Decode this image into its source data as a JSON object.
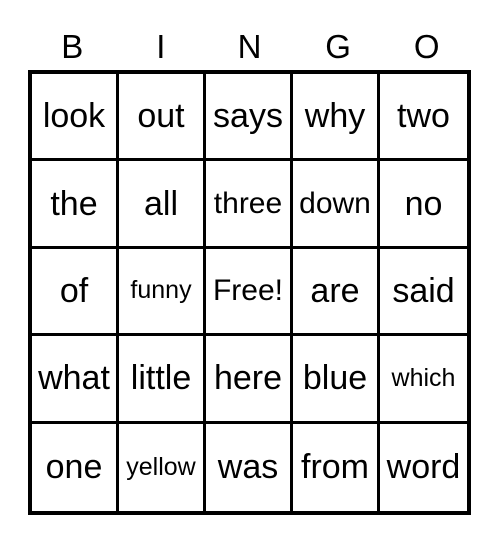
{
  "card": {
    "title_letters": [
      "B",
      "I",
      "N",
      "G",
      "O"
    ],
    "border_color": "#000000",
    "background_color": "#ffffff",
    "text_color": "#000000",
    "rows": 5,
    "columns": 5,
    "free_space": "Free!",
    "cells": [
      [
        {
          "text": "look",
          "size": "lg"
        },
        {
          "text": "out",
          "size": "lg"
        },
        {
          "text": "says",
          "size": "lg"
        },
        {
          "text": "why",
          "size": "lg"
        },
        {
          "text": "two",
          "size": "lg"
        }
      ],
      [
        {
          "text": "the",
          "size": "lg"
        },
        {
          "text": "all",
          "size": "lg"
        },
        {
          "text": "three",
          "size": "md"
        },
        {
          "text": "down",
          "size": "md"
        },
        {
          "text": "no",
          "size": "lg"
        }
      ],
      [
        {
          "text": "of",
          "size": "lg"
        },
        {
          "text": "funny",
          "size": "sm"
        },
        {
          "text": "Free!",
          "size": "md"
        },
        {
          "text": "are",
          "size": "lg"
        },
        {
          "text": "said",
          "size": "lg"
        }
      ],
      [
        {
          "text": "what",
          "size": "lg"
        },
        {
          "text": "little",
          "size": "lg"
        },
        {
          "text": "here",
          "size": "lg"
        },
        {
          "text": "blue",
          "size": "lg"
        },
        {
          "text": "which",
          "size": "sm"
        }
      ],
      [
        {
          "text": "one",
          "size": "lg"
        },
        {
          "text": "yellow",
          "size": "sm"
        },
        {
          "text": "was",
          "size": "lg"
        },
        {
          "text": "from",
          "size": "lg"
        },
        {
          "text": "word",
          "size": "lg"
        }
      ]
    ]
  }
}
